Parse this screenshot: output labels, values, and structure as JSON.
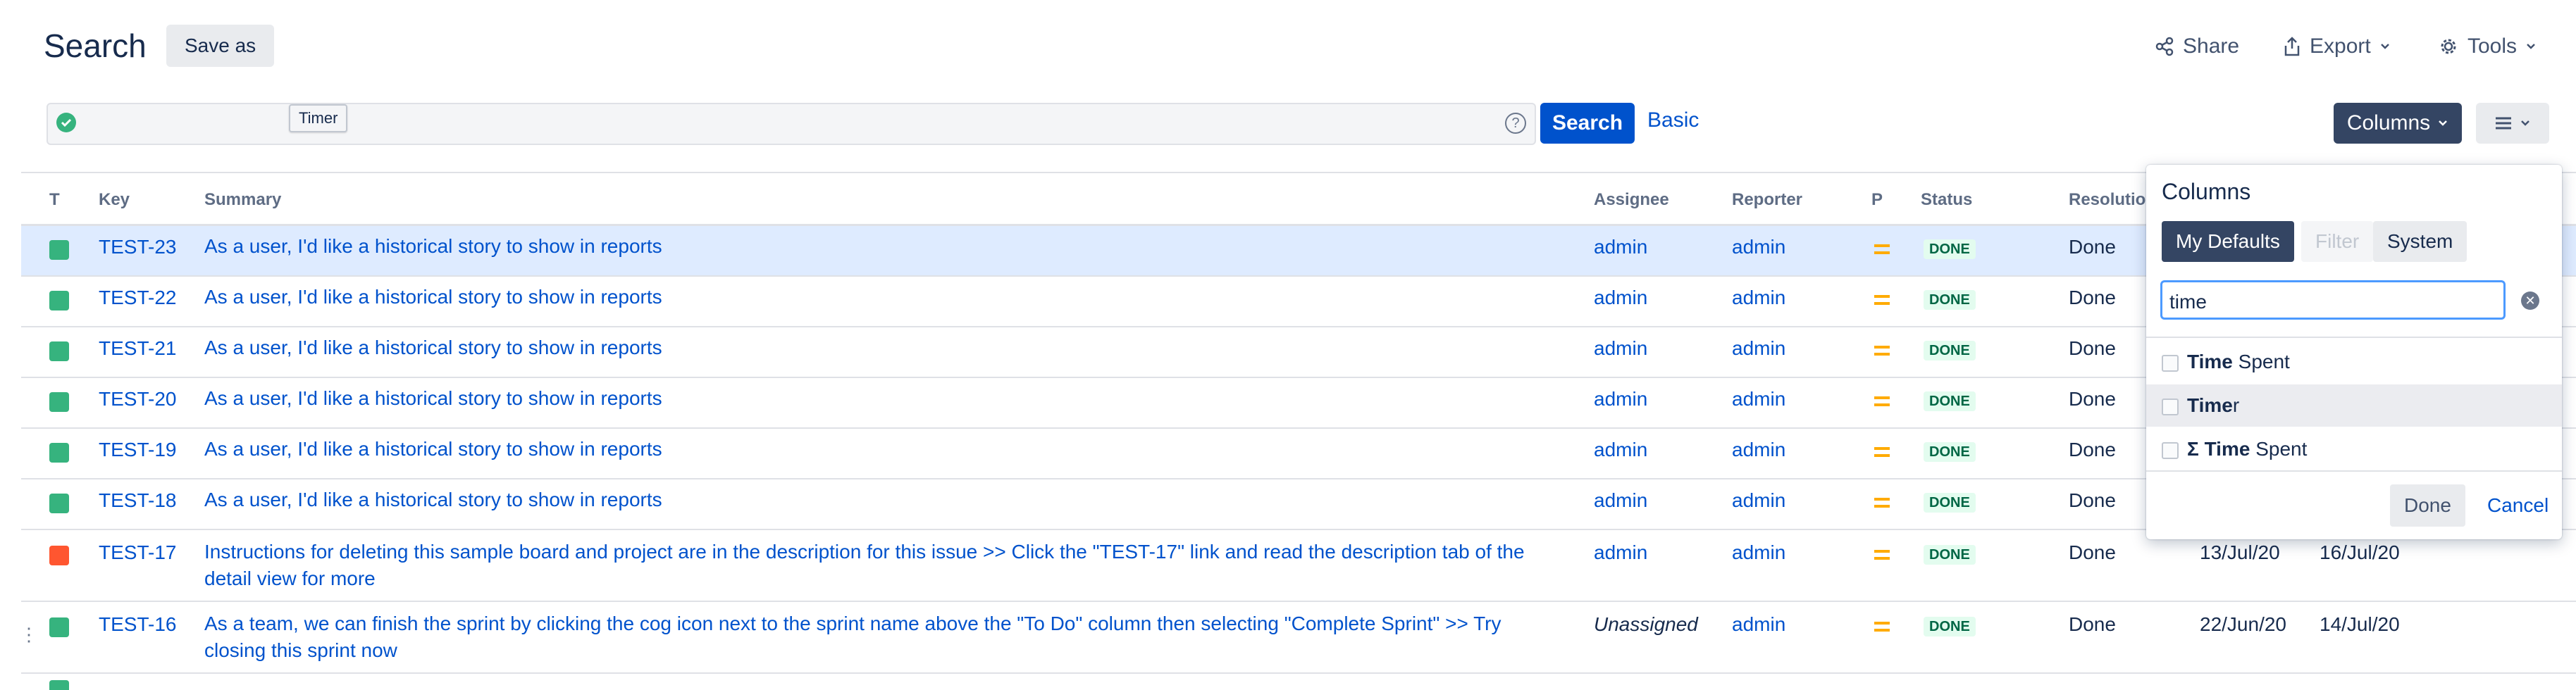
{
  "header": {
    "title": "Search",
    "save_as": "Save as",
    "share": "Share",
    "export": "Export",
    "tools": "Tools"
  },
  "searchbar": {
    "tooltip": "Timer",
    "help": "?",
    "search_label": "Search",
    "basic_label": "Basic"
  },
  "toolbar": {
    "columns_label": "Columns"
  },
  "table": {
    "headers": [
      "T",
      "Key",
      "Summary",
      "Assignee",
      "Reporter",
      "P",
      "Status",
      "Resolutio"
    ],
    "rows": [
      {
        "key": "TEST-23",
        "summary": "As a user, I'd like a historical story to show in reports",
        "assignee": "admin",
        "reporter": "admin",
        "status": "DONE",
        "resolution": "Done",
        "type": "story"
      },
      {
        "key": "TEST-22",
        "summary": "As a user, I'd like a historical story to show in reports",
        "assignee": "admin",
        "reporter": "admin",
        "status": "DONE",
        "resolution": "Done",
        "type": "story"
      },
      {
        "key": "TEST-21",
        "summary": "As a user, I'd like a historical story to show in reports",
        "assignee": "admin",
        "reporter": "admin",
        "status": "DONE",
        "resolution": "Done",
        "type": "story"
      },
      {
        "key": "TEST-20",
        "summary": "As a user, I'd like a historical story to show in reports",
        "assignee": "admin",
        "reporter": "admin",
        "status": "DONE",
        "resolution": "Done",
        "type": "story"
      },
      {
        "key": "TEST-19",
        "summary": "As a user, I'd like a historical story to show in reports",
        "assignee": "admin",
        "reporter": "admin",
        "status": "DONE",
        "resolution": "Done",
        "type": "story"
      },
      {
        "key": "TEST-18",
        "summary": "As a user, I'd like a historical story to show in reports",
        "assignee": "admin",
        "reporter": "admin",
        "status": "DONE",
        "resolution": "Done",
        "type": "story"
      },
      {
        "key": "TEST-17",
        "summary_line1": "Instructions for deleting this sample board and project are in the description for this issue >> Click the \"TEST-17\" link and read the description tab of the",
        "summary_line2": "detail view for more",
        "assignee": "admin",
        "reporter": "admin",
        "status": "DONE",
        "resolution": "Done",
        "created": "13/Jul/20",
        "updated": "16/Jul/20",
        "type": "bug"
      },
      {
        "key": "TEST-16",
        "summary_line1": "As a team, we can finish the sprint by clicking the cog icon next to the sprint name above the \"To Do\" column then selecting \"Complete Sprint\" >> Try",
        "summary_line2": "closing this sprint now",
        "assignee": "Unassigned",
        "reporter": "admin",
        "status": "DONE",
        "resolution": "Done",
        "created": "22/Jun/20",
        "updated": "14/Jul/20",
        "type": "story"
      }
    ]
  },
  "columns_panel": {
    "title": "Columns",
    "tabs": [
      "My Defaults",
      "Filter",
      "System"
    ],
    "search_value": "time",
    "options": [
      {
        "bold": "Time",
        "rest": " Spent"
      },
      {
        "bold": "Time",
        "rest": "r"
      },
      {
        "bold": "Σ Time",
        "rest": " Spent"
      }
    ],
    "done_label": "Done",
    "cancel_label": "Cancel"
  },
  "colors": {
    "accent": "#0052cc",
    "dark_button": "#344563",
    "selected_row": "#deebff",
    "done_green": "#006644",
    "priority_medium": "#ffab00"
  }
}
